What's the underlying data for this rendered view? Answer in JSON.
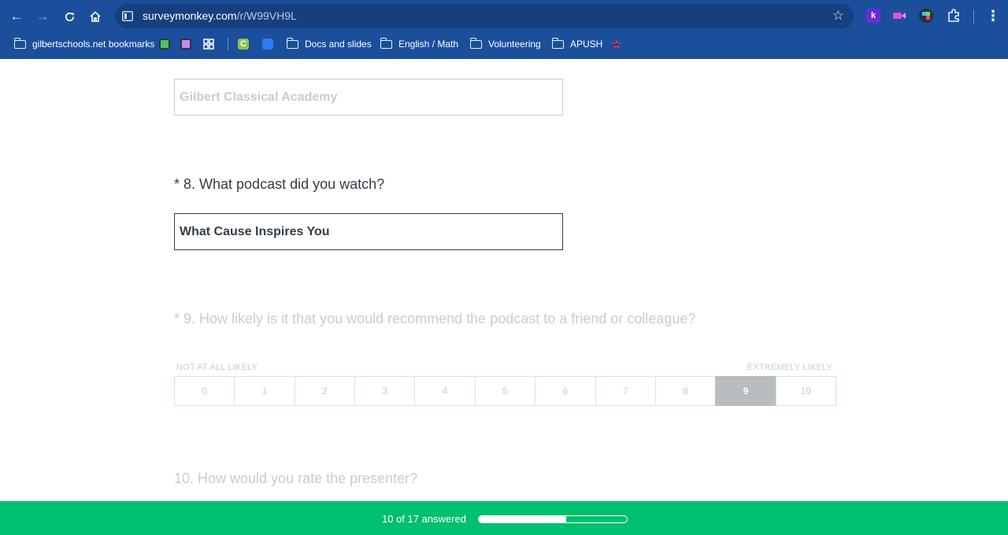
{
  "browser": {
    "url_host": "surveymonkey.com",
    "url_path": "/r/W99VH9L",
    "bookmarks": [
      {
        "label": "gilbertschools.net bookmarks",
        "type": "managed-folder"
      },
      {
        "label": "Docs and slides",
        "type": "folder"
      },
      {
        "label": "English / Math",
        "type": "folder"
      },
      {
        "label": "Volunteering",
        "type": "folder"
      },
      {
        "label": "APUSH",
        "type": "folder"
      }
    ],
    "ext_k_label": "k",
    "colors": {
      "chrome": "#1b4f9c",
      "omnibox": "#163f7e"
    }
  },
  "survey": {
    "prev_answer": {
      "value": "Gilbert Classical Academy"
    },
    "q8": {
      "label": "* 8. What podcast did you watch?",
      "value": "What Cause Inspires You"
    },
    "q9": {
      "label": "* 9. How likely is it that you would recommend the podcast to a friend or colleague?",
      "low_label": "NOT AT ALL LIKELY",
      "high_label": "EXTREMELY LIKELY",
      "options": [
        "0",
        "1",
        "2",
        "3",
        "4",
        "5",
        "6",
        "7",
        "8",
        "9",
        "10"
      ],
      "selected": "9"
    },
    "q10": {
      "label": "10. How would you rate the presenter?"
    }
  },
  "progress": {
    "text": "10 of 17 answered",
    "answered": 10,
    "total": 17,
    "colors": {
      "bar": "#00bf6f"
    }
  }
}
